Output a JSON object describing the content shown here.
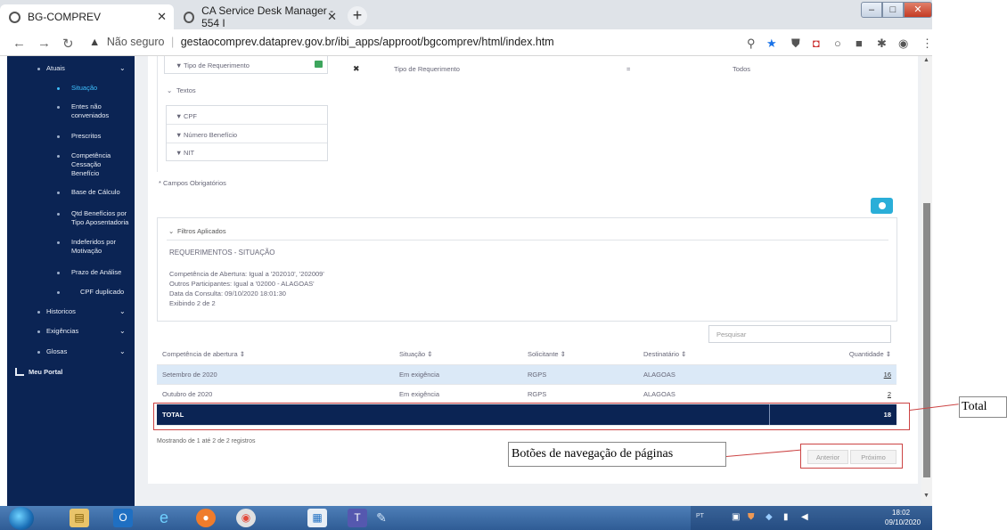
{
  "browser": {
    "tab1_title": "BG-COMPREV",
    "tab2_title": "CA Service Desk Manager - 554 I",
    "url_warning": "Não seguro",
    "url": "gestaocomprev.dataprev.gov.br/ibi_apps/approot/bgcomprev/html/index.htm"
  },
  "sidebar": {
    "atuais": "Atuais",
    "items": [
      "Situação",
      "Entes não conveniados",
      "Prescritos",
      "Competência Cessação Benefício",
      "Base de Cálculo",
      "Qtd Benefícios por Tipo Aposentadoria",
      "Indeferidos por Motivação",
      "Prazo de Análise",
      "CPF duplicado"
    ],
    "historicos": "Historicos",
    "exigencias": "Exigências",
    "glosas": "Glosas",
    "meu_portal": "Meu Portal"
  },
  "form": {
    "tipo_req": "Tipo de Requerimento",
    "textos": "Textos",
    "cpf": "CPF",
    "numero_beneficio": "Número Benefício",
    "nit": "NIT",
    "campos_obrigatorios": "* Campos Obrigatórios",
    "criteria_field": "Tipo de Requerimento",
    "criteria_op": "=",
    "criteria_value": "Todos"
  },
  "filters": {
    "header": "Filtros Aplicados",
    "title": "REQUERIMENTOS - SITUAÇÃO",
    "line1": "Competência de Abertura: Igual a '202010', '202009'",
    "line2": "Outros Participantes: Igual a '02000 - ALAGOAS'",
    "line3": "Data da Consulta: 09/10/2020 18:01:30",
    "line4": "Exibindo 2 de 2"
  },
  "search_placeholder": "Pesquisar",
  "table": {
    "headers": [
      "Competência de abertura ⇕",
      "Situação ⇕",
      "Solicitante ⇕",
      "Destinatário ⇕",
      "Quantidade ⇕"
    ],
    "rows": [
      [
        "Setembro de 2020",
        "Em exigência",
        "RGPS",
        "ALAGOAS",
        "16"
      ],
      [
        "Outubro de 2020",
        "Em exigência",
        "RGPS",
        "ALAGOAS",
        "2"
      ]
    ],
    "total_label": "TOTAL",
    "total_value": "18"
  },
  "showing": "Mostrando de 1 até 2 de 2 registros",
  "pager": {
    "prev": "Anterior",
    "next": "Próximo"
  },
  "annotations": {
    "total": "Total",
    "navigation": "Botões de navegação de páginas"
  },
  "taskbar": {
    "lang": "PT",
    "time": "18:02",
    "date": "09/10/2020"
  }
}
